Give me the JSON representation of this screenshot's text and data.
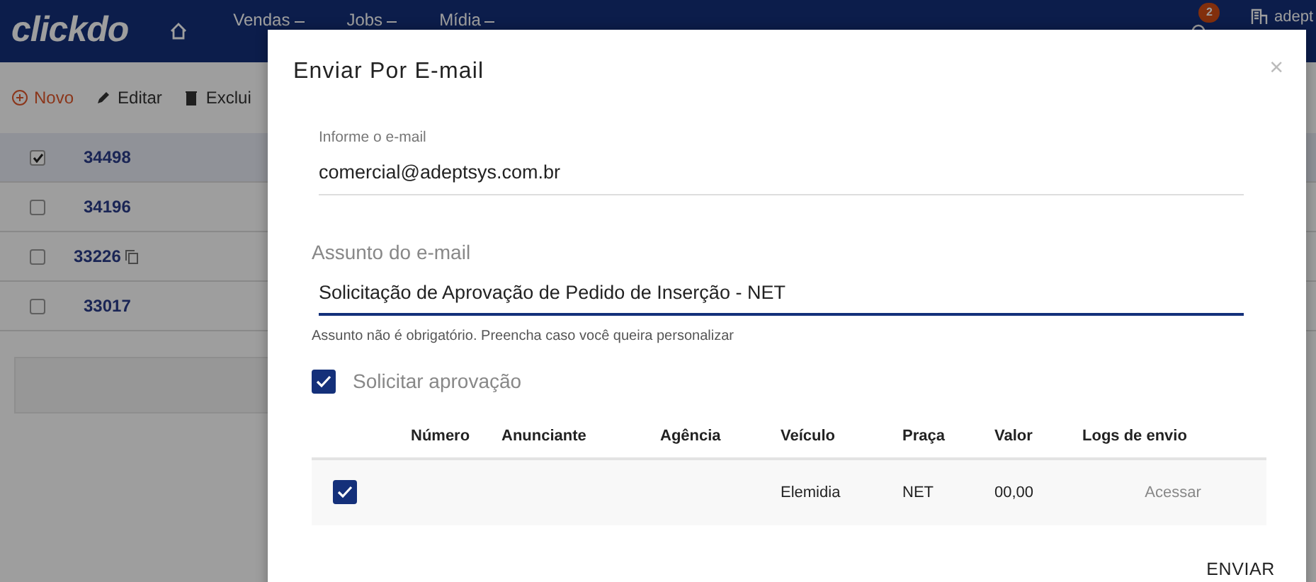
{
  "navbar": {
    "logo": "clickdo",
    "items": [
      {
        "label": "Vendas"
      },
      {
        "label": "Jobs"
      },
      {
        "label": "Mídia"
      }
    ],
    "notification_count": "2",
    "user": "adept"
  },
  "toolbar": [
    {
      "label": "Novo",
      "kind": "new"
    },
    {
      "label": "Editar",
      "kind": "edit"
    },
    {
      "label": "Exclui",
      "kind": "delete"
    }
  ],
  "list_rows": [
    {
      "number": "34498",
      "selected": true,
      "copy": false
    },
    {
      "number": "34196",
      "selected": false,
      "copy": false
    },
    {
      "number": "33226",
      "selected": false,
      "copy": true
    },
    {
      "number": "33017",
      "selected": false,
      "copy": false
    }
  ],
  "modal": {
    "title": "Enviar Por E-mail",
    "close": "×",
    "email_field": {
      "label": "Informe o e-mail",
      "value": "comercial@adeptsys.com.br"
    },
    "subject_field": {
      "label": "Assunto do e-mail",
      "value": "Solicitação de Aprovação de Pedido de Inserção - NET",
      "helper": "Assunto não é obrigatório. Preencha caso você queira personalizar"
    },
    "request_approval": {
      "label": "Solicitar aprovação",
      "checked": true
    },
    "table": {
      "columns": [
        "Número",
        "Anunciante",
        "Agência",
        "Veículo",
        "Praça",
        "Valor",
        "Logs de envio"
      ],
      "rows": [
        {
          "checked": true,
          "cells": {
            "veiculo": "Elemidia",
            "praca": "NET",
            "valor": "00,00"
          },
          "logs_link": "Acessar"
        }
      ]
    },
    "submit": "ENVIAR"
  }
}
